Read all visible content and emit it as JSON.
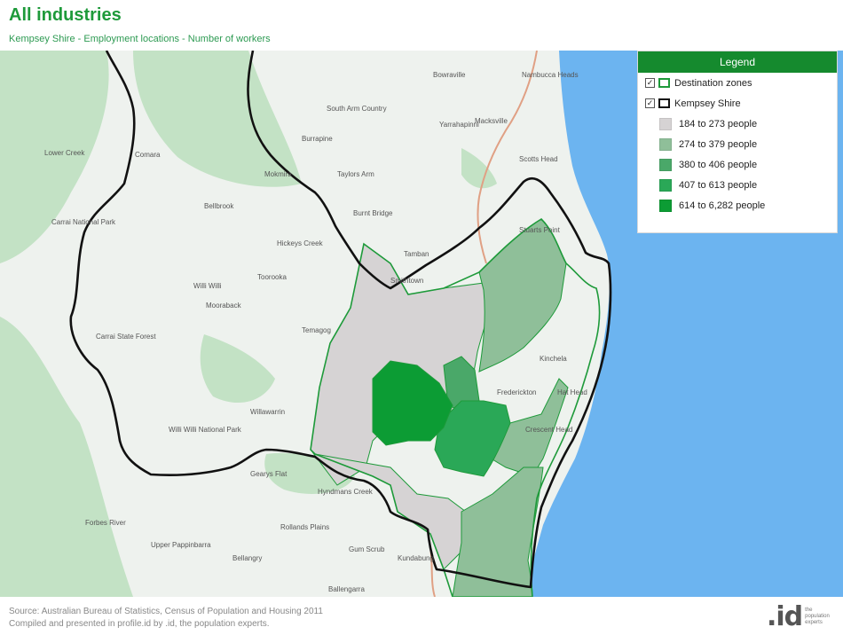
{
  "page": {
    "title": "All industries",
    "subtitle": "Kempsey Shire - Employment locations - Number of workers"
  },
  "legend": {
    "header": "Legend",
    "layers": [
      {
        "label": "Destination zones",
        "checked": true,
        "outline_color": "#1e9a3a"
      },
      {
        "label": "Kempsey Shire",
        "checked": true,
        "outline_color": "#111111"
      }
    ],
    "classes": [
      {
        "label": "184 to 273 people",
        "color": "#d6d3d4"
      },
      {
        "label": "274 to 379 people",
        "color": "#8fbf99"
      },
      {
        "label": "380 to 406 people",
        "color": "#4aa869"
      },
      {
        "label": "407 to 613 people",
        "color": "#2aa857"
      },
      {
        "label": "614 to 6,282 people",
        "color": "#0c9c34"
      }
    ],
    "check_mark": "✓"
  },
  "map": {
    "colors": {
      "ocean": "#6cb4f0",
      "land": "#eef2ee",
      "forest": "#c3e2c5",
      "road": "#e0a084",
      "shire_outline": "#111111",
      "zone_outline": "#1e9a3a"
    },
    "places": [
      {
        "name": "Lower Creek"
      },
      {
        "name": "Comara"
      },
      {
        "name": "Carrai National Park"
      },
      {
        "name": "Willi Willi"
      },
      {
        "name": "Carrai State Forest"
      },
      {
        "name": "Toorooka"
      },
      {
        "name": "Mooraback"
      },
      {
        "name": "Willawarrin"
      },
      {
        "name": "Willi Willi National Park"
      },
      {
        "name": "Bellbrook"
      },
      {
        "name": "Hickeys Creek"
      },
      {
        "name": "Temagog"
      },
      {
        "name": "Mokmira"
      },
      {
        "name": "Burnt Bridge"
      },
      {
        "name": "Tamban"
      },
      {
        "name": "South Arm Country"
      },
      {
        "name": "Burrapine"
      },
      {
        "name": "Taylors Arm"
      },
      {
        "name": "Bowraville"
      },
      {
        "name": "Macksville"
      },
      {
        "name": "Nambucca Heads"
      },
      {
        "name": "Yarrahapinni"
      },
      {
        "name": "Scotts Head"
      },
      {
        "name": "Stuarts Point"
      },
      {
        "name": "Kinchela"
      },
      {
        "name": "Gearys Flat"
      },
      {
        "name": "Hat Head"
      },
      {
        "name": "Crescent Head"
      },
      {
        "name": "Forbes River"
      },
      {
        "name": "Upper Pappinbarra"
      },
      {
        "name": "Bellangry"
      },
      {
        "name": "Rollands Plains"
      },
      {
        "name": "Gum Scrub"
      },
      {
        "name": "Hyndmans Creek"
      },
      {
        "name": "Ballengarra"
      },
      {
        "name": "Kundabung"
      },
      {
        "name": "Frederickton"
      },
      {
        "name": "Smithtown"
      }
    ]
  },
  "footer": {
    "source": "Source: Australian Bureau of Statistics, Census of Population and Housing 2011",
    "compiled": "Compiled and presented in profile.id by .id, the population experts.",
    "logo": ".id",
    "logo_tag": "the population experts"
  }
}
